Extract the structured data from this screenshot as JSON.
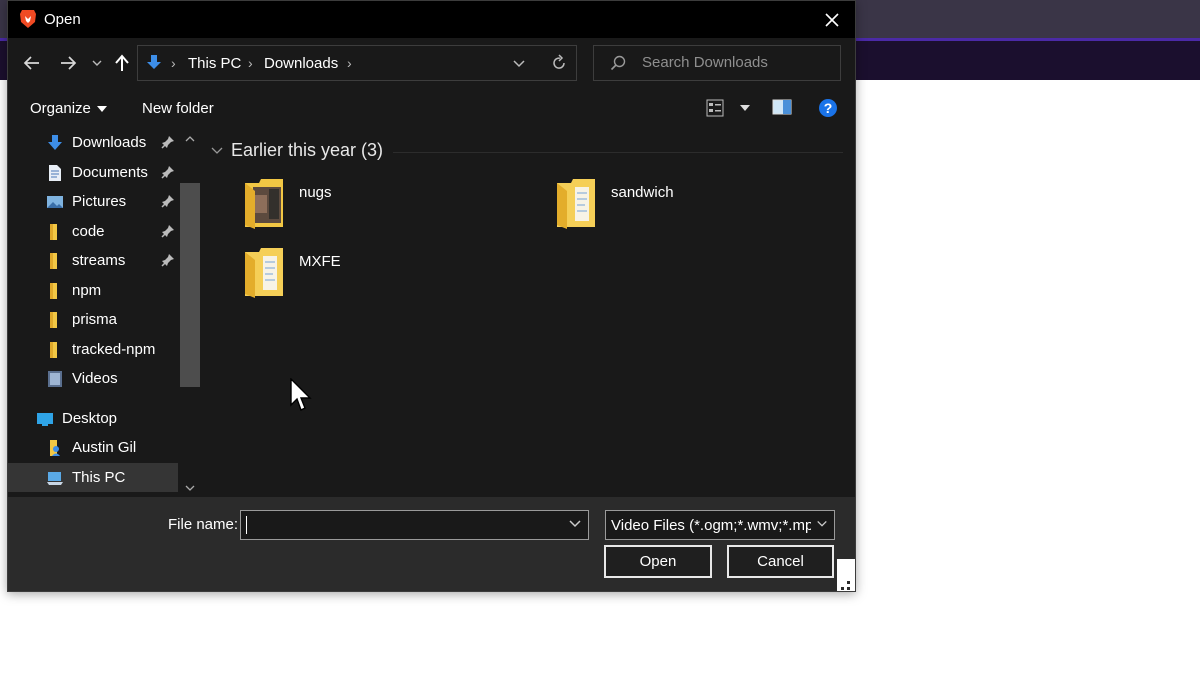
{
  "background": {
    "strip_color": "#3a3547",
    "dark_color": "#1b0f2e",
    "accent": "#4b2aa6"
  },
  "dialog": {
    "title": "Open",
    "app_icon": "brave-lion-icon",
    "close_icon": "close-icon"
  },
  "navigation": {
    "back_icon": "arrow-left-icon",
    "forward_icon": "arrow-right-icon",
    "recent_icon": "chevron-down-icon",
    "up_icon": "arrow-up-icon",
    "breadcrumbs": [
      "This PC",
      "Downloads"
    ],
    "refresh_icon": "refresh-icon"
  },
  "search": {
    "placeholder": "Search Downloads"
  },
  "toolbar": {
    "organize_label": "Organize",
    "new_folder_label": "New folder",
    "view_icon": "view-options-icon",
    "preview_icon": "preview-pane-icon",
    "help_icon": "help-icon"
  },
  "sidebar": {
    "items": [
      {
        "label": "Downloads",
        "icon": "download-arrow-icon",
        "pinned": true
      },
      {
        "label": "Documents",
        "icon": "document-icon",
        "pinned": true
      },
      {
        "label": "Pictures",
        "icon": "pictures-icon",
        "pinned": true
      },
      {
        "label": "code",
        "icon": "folder-icon",
        "pinned": true
      },
      {
        "label": "streams",
        "icon": "folder-icon",
        "pinned": true
      },
      {
        "label": "npm",
        "icon": "folder-icon",
        "pinned": false
      },
      {
        "label": "prisma",
        "icon": "folder-icon",
        "pinned": false
      },
      {
        "label": "tracked-npm",
        "icon": "folder-icon",
        "pinned": false
      },
      {
        "label": "Videos",
        "icon": "videos-icon",
        "pinned": false
      },
      {
        "label": "Desktop",
        "icon": "desktop-icon",
        "pinned": false
      },
      {
        "label": "Austin Gil",
        "icon": "user-folder-icon",
        "pinned": false
      },
      {
        "label": "This PC",
        "icon": "this-pc-icon",
        "pinned": false,
        "selected": true
      }
    ]
  },
  "content": {
    "group_title": "Earlier this year (3)",
    "folders": [
      {
        "name": "nugs",
        "icon": "folder-with-image-icon"
      },
      {
        "name": "sandwich",
        "icon": "folder-icon"
      },
      {
        "name": "MXFE",
        "icon": "folder-icon"
      }
    ]
  },
  "bottom": {
    "file_name_label": "File name:",
    "file_name_value": "",
    "file_type_value": "Video Files (*.ogm;*.wmv;*.mpg",
    "open_label": "Open",
    "cancel_label": "Cancel"
  }
}
